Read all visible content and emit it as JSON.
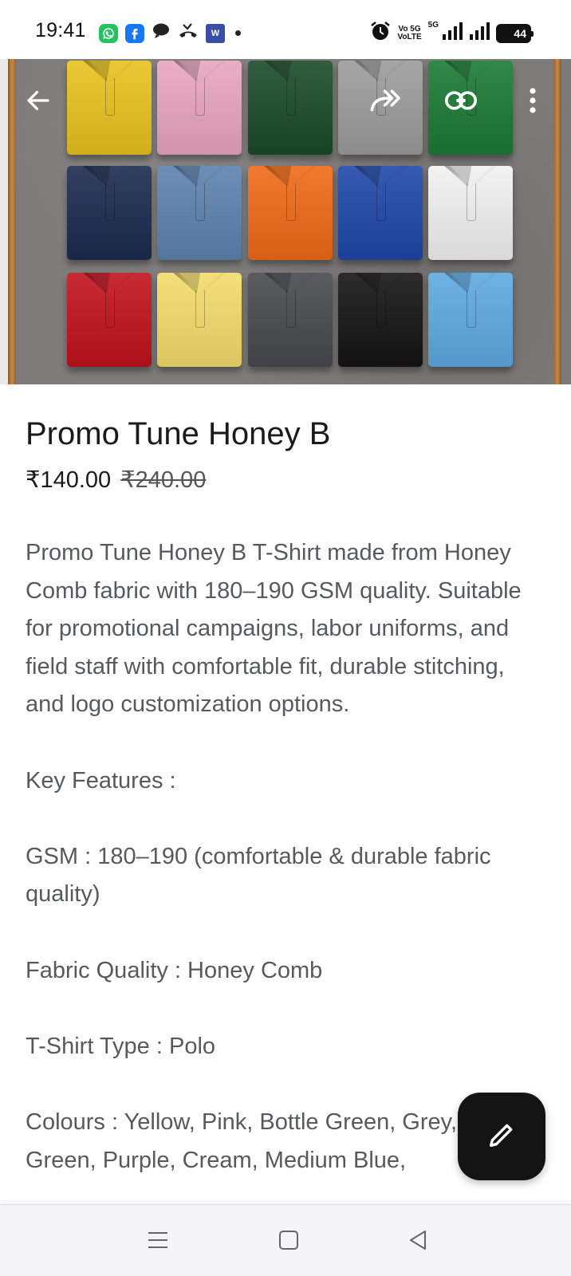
{
  "status_bar": {
    "time": "19:41",
    "notification_icons": [
      "whatsapp-icon",
      "facebook-icon",
      "chat-icon",
      "missed-call-icon",
      "w-app-icon"
    ],
    "network_label_top": "Vo 5G",
    "network_label_bottom": "VoLTE",
    "network_type": "5G",
    "battery_level": "44",
    "icons": [
      "alarm-icon",
      "signal-icon",
      "signal-icon",
      "battery-icon"
    ]
  },
  "hero": {
    "icons": [
      "back-arrow-icon",
      "share-icon",
      "link-icon",
      "more-vert-icon"
    ],
    "shirt_colors": [
      [
        "#e8c21f",
        "#e7a6bf",
        "#1b4a2a",
        "#9b9c9b",
        "#1b7a34"
      ],
      [
        "#1c2a4e",
        "#5d82ad",
        "#f06a17",
        "#1f47a8",
        "#f1f1f1"
      ],
      [
        "#c1121c",
        "#f3dc6b",
        "#47494d",
        "#141414",
        "#5ea9e1"
      ]
    ]
  },
  "product": {
    "title": "Promo Tune Honey B",
    "price": "₹140.00",
    "original_price": "₹240.00",
    "description": "Promo Tune Honey B T-Shirt made from Honey Comb fabric with 180–190 GSM quality. Suitable for promotional campaigns, labor uniforms, and field staff with comfortable fit, durable stitching, and logo customization options.\n\nKey Features :\n\nGSM : 180–190 (comfortable & durable fabric quality)\n\nFabric Quality : Honey Comb\n\nT-Shirt Type : Polo\n\nColours : Yellow, Pink, Bottle Green, Grey, Olive Green, Purple, Cream, Medium Blue,"
  },
  "fab": {
    "icon": "edit-pencil-icon"
  },
  "nav_bar": {
    "icons": [
      "menu-icon",
      "home-square-icon",
      "back-triangle-icon"
    ]
  },
  "colors": {
    "accent_dark": "#141414",
    "text_primary": "#1a1a1a",
    "text_secondary": "#555a5f"
  }
}
